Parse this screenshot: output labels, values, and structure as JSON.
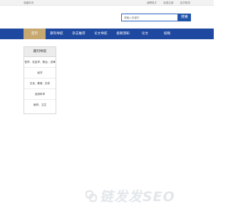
{
  "topbar": {
    "favorite": "收藏本页",
    "links": [
      "诚聘英才",
      "免费注册",
      "会员登录"
    ]
  },
  "search": {
    "placeholder": "请输入关键字",
    "button": "搜索"
  },
  "nav": {
    "items": [
      {
        "label": "首页",
        "active": true
      },
      {
        "label": "期刊导航"
      },
      {
        "label": "杂志推荐"
      },
      {
        "label": "论文导航"
      },
      {
        "label": "投稿须知"
      },
      {
        "label": "论文"
      },
      {
        "label": "投稿"
      }
    ]
  },
  "sidebar": {
    "title": "期刊导航",
    "items": [
      {
        "label": "哲学、社会学、政治、法律"
      },
      {
        "label": "经济"
      },
      {
        "label": "文化、教育、历史"
      },
      {
        "label": "自然科学"
      },
      {
        "label": "医药、卫生"
      }
    ]
  },
  "watermark": {
    "text": "链发发SEO"
  },
  "colors": {
    "nav_bg": "#1f48a0",
    "nav_active": "#c6a870",
    "search_border": "#2a66c2",
    "search_button": "#2052a8",
    "watermark": "#e3e7eb"
  }
}
